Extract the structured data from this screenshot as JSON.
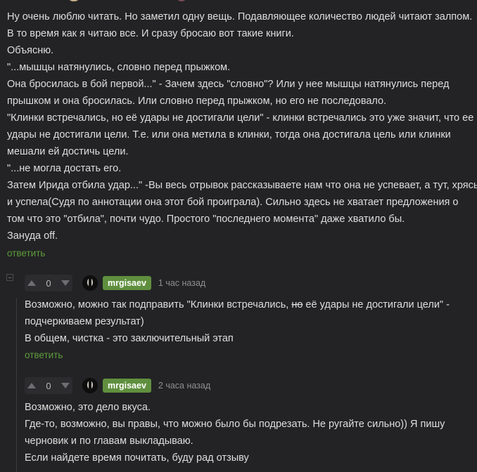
{
  "main_comment": {
    "lines": [
      "Ну очень люблю читать. Но заметил одну вещь. Подавляющее количество людей читают залпом.",
      "В то время как я читаю все. И сразу бросаю вот такие книги.",
      "Объясню.",
      "\"...мышцы натянулись, словно перед прыжком.",
      "Она бросилась в бой первой...\" - Зачем здесь \"словно\"? Или у нее мышцы натянулись перед",
      "прышком и она бросилась. Или словно перед прыжком, но его не последовало.",
      "\"Клинки встречались, но её удары не достигали цели\" - клинки встречались это уже значит, что ее",
      "удары не достигали цели. Т.е. или она метила в клинки, тогда она достигала цель или клинки",
      "мешали ей достичь цели.",
      "\"...не могла достать его.",
      "Затем Ирида отбила удар...\" -Вы весь отрывок рассказываете нам что она не успевает, а тут, хрясь",
      "и успела(Судя по аннотации она этот бой проиграла). Сильно здесь не хватает предложения о",
      "том что это \"отбила\", почти чудо. Простого \"последнего момента\" даже хватило бы.",
      "Зануда off."
    ],
    "reply_label": "ответить"
  },
  "reply1": {
    "score": "0",
    "author": "mrgisaev",
    "time": "1 час назад",
    "line1_before": "Возможно, можно так подправить \"Клинки встречались, ",
    "line1_strike": "но",
    "line1_after": " её удары не достигали цели\" -",
    "line2": "подчеркиваем результат)",
    "line3": "В общем, чистка - это заключительный этап",
    "reply_label": "ответить"
  },
  "reply2": {
    "score": "0",
    "author": "mrgisaev",
    "time": "2 часа назад",
    "lines": [
      "Возможно, это дело вкуса.",
      "Где-то, возможно, вы правы, что можно было бы подрезать. Не ругайте сильно)) Я пишу",
      "черновик и по главам выкладываю.",
      "Если найдете время почитать, буду рад отзыву"
    ]
  },
  "colors": {
    "background": "#232325",
    "text": "#dedede",
    "accent_green": "#5d9c3a",
    "nick_badge": "#5f8f3e"
  },
  "icons": {
    "vote_up": "caret-up-icon",
    "vote_down": "caret-down-icon",
    "collapse": "collapse-minus-icon"
  }
}
